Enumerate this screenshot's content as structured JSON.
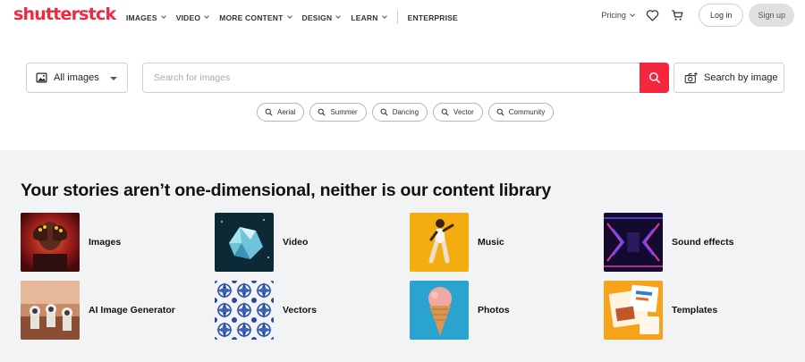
{
  "nav": {
    "logo": "shutterstck",
    "menu": [
      {
        "label": "IMAGES",
        "has_dropdown": true
      },
      {
        "label": "VIDEO",
        "has_dropdown": true
      },
      {
        "label": "MORE CONTENT",
        "has_dropdown": true
      },
      {
        "label": "DESIGN",
        "has_dropdown": true
      },
      {
        "label": "LEARN",
        "has_dropdown": true
      },
      {
        "label": "ENTERPRISE",
        "has_dropdown": false
      }
    ],
    "pricing": "Pricing",
    "login": "Log in",
    "signup": "Sign up",
    "icons": {
      "favorites": "heart-icon",
      "cart": "cart-icon"
    }
  },
  "search": {
    "type_value": "All images",
    "placeholder": "Search for images",
    "image_search_label": "Search by image",
    "suggestions": [
      "Aerial",
      "Summer",
      "Dancing",
      "Vector",
      "Community"
    ],
    "accent_color": "#f5273f"
  },
  "library": {
    "headline": "Your stories aren’t one-dimensional, neither is our content library",
    "categories": [
      {
        "label": "Images"
      },
      {
        "label": "Video"
      },
      {
        "label": "Music"
      },
      {
        "label": "Sound effects"
      },
      {
        "label": "AI Image Generator"
      },
      {
        "label": "Vectors"
      },
      {
        "label": "Photos"
      },
      {
        "label": "Templates"
      }
    ]
  }
}
